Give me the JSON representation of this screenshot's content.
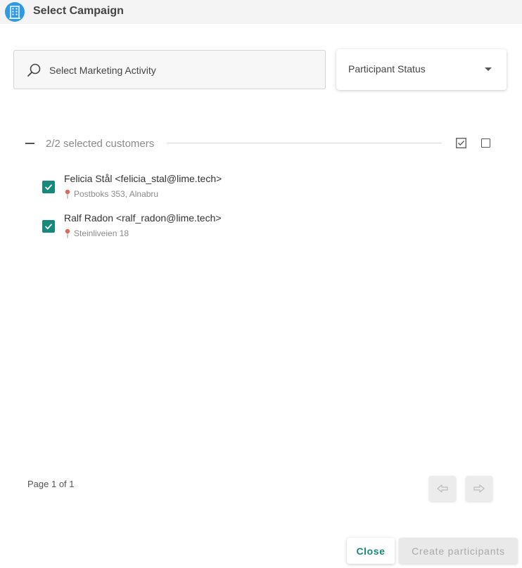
{
  "header": {
    "title": "Select Campaign",
    "icon": "building-icon"
  },
  "search": {
    "placeholder": "Select Marketing Activity",
    "value": ""
  },
  "status_select": {
    "label": "Participant Status"
  },
  "group": {
    "label": "2/2 selected customers"
  },
  "customers": [
    {
      "name": "Felicia Stål <felicia_stal@lime.tech>",
      "address": "Postboks 353, Alnabru",
      "checked": true
    },
    {
      "name": "Ralf Radon <ralf_radon@lime.tech>",
      "address": "Steinliveien 18",
      "checked": true
    }
  ],
  "pagination": {
    "label": "Page 1 of 1",
    "prev_icon": "arrow-left-icon",
    "next_icon": "arrow-right-icon"
  },
  "footer": {
    "close_label": "Close",
    "create_label": "Create participants"
  },
  "colors": {
    "accent": "#17897c",
    "header_icon": "#2f9ae0",
    "header_bg": "#f4f4f4"
  }
}
